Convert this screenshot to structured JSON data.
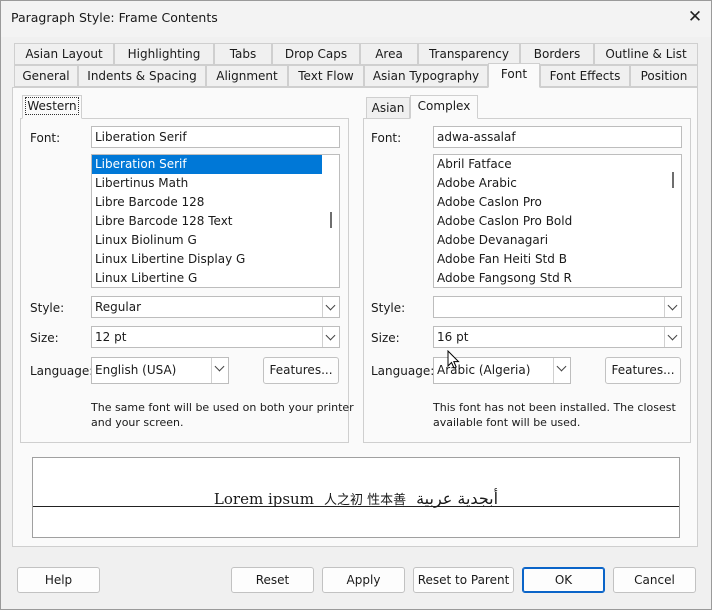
{
  "window": {
    "title": "Paragraph Style: Frame Contents"
  },
  "tabs": {
    "row1": [
      "Asian Layout",
      "Highlighting",
      "Tabs",
      "Drop Caps",
      "Area",
      "Transparency",
      "Borders",
      "Outline & List"
    ],
    "row2": [
      "General",
      "Indents & Spacing",
      "Alignment",
      "Text Flow",
      "Asian Typography",
      "Font",
      "Font Effects",
      "Position"
    ],
    "active": "Font"
  },
  "western": {
    "tab_label": "Western",
    "font_label": "Font:",
    "font_value": "Liberation Serif",
    "font_list": [
      "Liberation Serif",
      "Libertinus Math",
      "Libre Barcode 128",
      "Libre Barcode 128 Text",
      "Linux Biolinum G",
      "Linux Libertine Display G",
      "Linux Libertine G"
    ],
    "style_label": "Style:",
    "style_value": "Regular",
    "size_label": "Size:",
    "size_value": "12 pt",
    "language_label": "Language:",
    "language_value": "English (USA)",
    "features_label": "Features...",
    "note_line1": "The same font will be used on both your printer",
    "note_line2": "and your screen."
  },
  "complex": {
    "tab_asian_label": "Asian",
    "tab_complex_label": "Complex",
    "font_label": "Font:",
    "font_value": "adwa-assalaf",
    "font_list": [
      "Abril Fatface",
      "Adobe Arabic",
      "Adobe Caslon Pro",
      "Adobe Caslon Pro Bold",
      "Adobe Devanagari",
      "Adobe Fan Heiti Std B",
      "Adobe Fangsong Std R"
    ],
    "style_label": "Style:",
    "style_value": "",
    "size_label": "Size:",
    "size_value": "16 pt",
    "language_label": "Language:",
    "language_value": "Arabic (Algeria)",
    "features_label": "Features...",
    "note_line1": "This font has not been installed. The closest",
    "note_line2": "available font will be used."
  },
  "preview": {
    "latin": "Lorem ipsum",
    "cjk": "人之初 性本善",
    "arabic": "أبجدية عربية"
  },
  "buttons": {
    "help": "Help",
    "reset": "Reset",
    "apply": "Apply",
    "reset_to_parent": "Reset to Parent",
    "ok": "OK",
    "cancel": "Cancel"
  },
  "colors": {
    "selection": "#0078d7",
    "default_button_border": "#0a64c8"
  }
}
